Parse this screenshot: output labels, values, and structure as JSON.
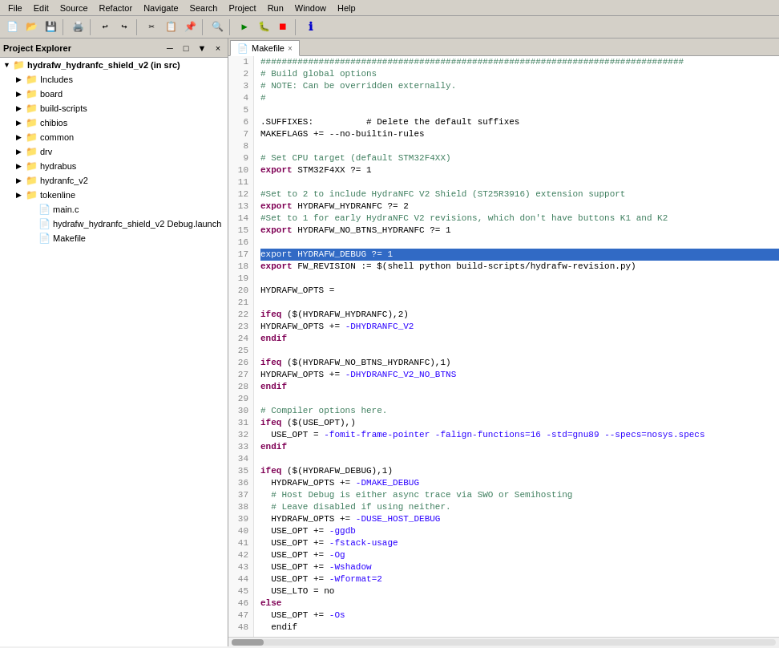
{
  "menubar": {
    "items": [
      "File",
      "Edit",
      "Source",
      "Refactor",
      "Navigate",
      "Search",
      "Project",
      "Run",
      "Window",
      "Help"
    ]
  },
  "panel": {
    "title": "Project Explorer",
    "close_label": "×",
    "minimize_label": "─",
    "maximize_label": "□"
  },
  "tree": {
    "root": "hydrafw_hydranfc_shield_v2 (in src)",
    "items": [
      {
        "label": "Includes",
        "type": "folder",
        "indent": 1,
        "expanded": false
      },
      {
        "label": "board",
        "type": "folder",
        "indent": 1,
        "expanded": false
      },
      {
        "label": "build-scripts",
        "type": "folder",
        "indent": 1,
        "expanded": false
      },
      {
        "label": "chibios",
        "type": "folder",
        "indent": 1,
        "expanded": false
      },
      {
        "label": "common",
        "type": "folder",
        "indent": 1,
        "expanded": false
      },
      {
        "label": "drv",
        "type": "folder",
        "indent": 1,
        "expanded": false
      },
      {
        "label": "hydrabus",
        "type": "folder",
        "indent": 1,
        "expanded": false
      },
      {
        "label": "hydranfc_v2",
        "type": "folder",
        "indent": 1,
        "expanded": false
      },
      {
        "label": "tokenline",
        "type": "folder",
        "indent": 1,
        "expanded": false
      },
      {
        "label": "main.c",
        "type": "c-file",
        "indent": 1
      },
      {
        "label": "hydrafw_hydranfc_shield_v2 Debug.launch",
        "type": "launch-file",
        "indent": 1
      },
      {
        "label": "Makefile",
        "type": "makefile",
        "indent": 1
      }
    ]
  },
  "editor": {
    "tab_label": "Makefile",
    "tab_icon": "📄"
  },
  "code": {
    "lines": [
      {
        "num": 1,
        "text": "################################################################################",
        "type": "comment"
      },
      {
        "num": 2,
        "text": "# Build global options",
        "type": "comment"
      },
      {
        "num": 3,
        "text": "# NOTE: Can be overridden externally.",
        "type": "comment"
      },
      {
        "num": 4,
        "text": "#",
        "type": "comment"
      },
      {
        "num": 5,
        "text": ""
      },
      {
        "num": 6,
        "text": ".SUFFIXES:          # Delete the default suffixes",
        "type": "mixed"
      },
      {
        "num": 7,
        "text": "MAKEFLAGS += --no-builtin-rules",
        "type": "make"
      },
      {
        "num": 8,
        "text": ""
      },
      {
        "num": 9,
        "text": "# Set CPU target (default STM32F4XX)",
        "type": "comment"
      },
      {
        "num": 10,
        "text": "export STM32F4XX ?= 1",
        "type": "export"
      },
      {
        "num": 11,
        "text": ""
      },
      {
        "num": 12,
        "text": "#Set to 2 to include HydraNFC V2 Shield (ST25R3916) extension support",
        "type": "comment"
      },
      {
        "num": 13,
        "text": "export HYDRAFW_HYDRANFC ?= 2",
        "type": "export"
      },
      {
        "num": 14,
        "text": "#Set to 1 for early HydraNFC V2 revisions, which don't have buttons K1 and K2",
        "type": "comment"
      },
      {
        "num": 15,
        "text": "export HYDRAFW_NO_BTNS_HYDRANFC ?= 1",
        "type": "export"
      },
      {
        "num": 16,
        "text": ""
      },
      {
        "num": 17,
        "text": "export HYDRAFW_DEBUG ?= 1",
        "type": "export",
        "highlighted": true
      },
      {
        "num": 18,
        "text": "export FW_REVISION := $(shell python build-scripts/hydrafw-revision.py)",
        "type": "export"
      },
      {
        "num": 19,
        "text": ""
      },
      {
        "num": 20,
        "text": "HYDRAFW_OPTS =",
        "type": "make"
      },
      {
        "num": 21,
        "text": ""
      },
      {
        "num": 22,
        "text": "ifeq ($(HYDRAFW_HYDRANFC),2)",
        "type": "ifeq"
      },
      {
        "num": 23,
        "text": "HYDRAFW_OPTS += -DHYDRANFC_V2",
        "type": "make-indent"
      },
      {
        "num": 24,
        "text": "endif",
        "type": "endif"
      },
      {
        "num": 25,
        "text": ""
      },
      {
        "num": 26,
        "text": "ifeq ($(HYDRAFW_NO_BTNS_HYDRANFC),1)",
        "type": "ifeq"
      },
      {
        "num": 27,
        "text": "HYDRAFW_OPTS += -DHYDRANFC_V2_NO_BTNS",
        "type": "make-indent"
      },
      {
        "num": 28,
        "text": "endif",
        "type": "endif"
      },
      {
        "num": 29,
        "text": ""
      },
      {
        "num": 30,
        "text": "# Compiler options here.",
        "type": "comment"
      },
      {
        "num": 31,
        "text": "ifeq ($(USE_OPT),)",
        "type": "ifeq"
      },
      {
        "num": 32,
        "text": "  USE_OPT = -fomit-frame-pointer -falign-functions=16 -std=gnu89 --specs=nosys.specs",
        "type": "make-indent2"
      },
      {
        "num": 33,
        "text": "endif",
        "type": "endif"
      },
      {
        "num": 34,
        "text": ""
      },
      {
        "num": 35,
        "text": "ifeq ($(HYDRAFW_DEBUG),1)",
        "type": "ifeq"
      },
      {
        "num": 36,
        "text": "  HYDRAFW_OPTS += -DMAKE_DEBUG",
        "type": "make-indent2"
      },
      {
        "num": 37,
        "text": "  # Host Debug is either async trace via SWO or Semihosting",
        "type": "comment-indent"
      },
      {
        "num": 38,
        "text": "  # Leave disabled if using neither.",
        "type": "comment-indent"
      },
      {
        "num": 39,
        "text": "  HYDRAFW_OPTS += -DUSE_HOST_DEBUG",
        "type": "make-indent2"
      },
      {
        "num": 40,
        "text": "  USE_OPT += -ggdb",
        "type": "make-indent2"
      },
      {
        "num": 41,
        "text": "  USE_OPT += -fstack-usage",
        "type": "make-indent2"
      },
      {
        "num": 42,
        "text": "  USE_OPT += -Og",
        "type": "make-indent2"
      },
      {
        "num": 43,
        "text": "  USE_OPT += -Wshadow",
        "type": "make-indent2"
      },
      {
        "num": 44,
        "text": "  USE_OPT += -Wformat=2",
        "type": "make-indent2"
      },
      {
        "num": 45,
        "text": "  USE_LTO = no",
        "type": "make-indent2"
      },
      {
        "num": 46,
        "text": "else",
        "type": "else"
      },
      {
        "num": 47,
        "text": "  USE_OPT += -Os",
        "type": "make-indent2"
      },
      {
        "num": 48,
        "text": "  endif",
        "type": "endif"
      }
    ]
  },
  "icons": {
    "folder": "📁",
    "c_file": "📄",
    "makefile": "📄",
    "launch": "📄",
    "triangle_right": "▶",
    "triangle_down": "▼"
  }
}
